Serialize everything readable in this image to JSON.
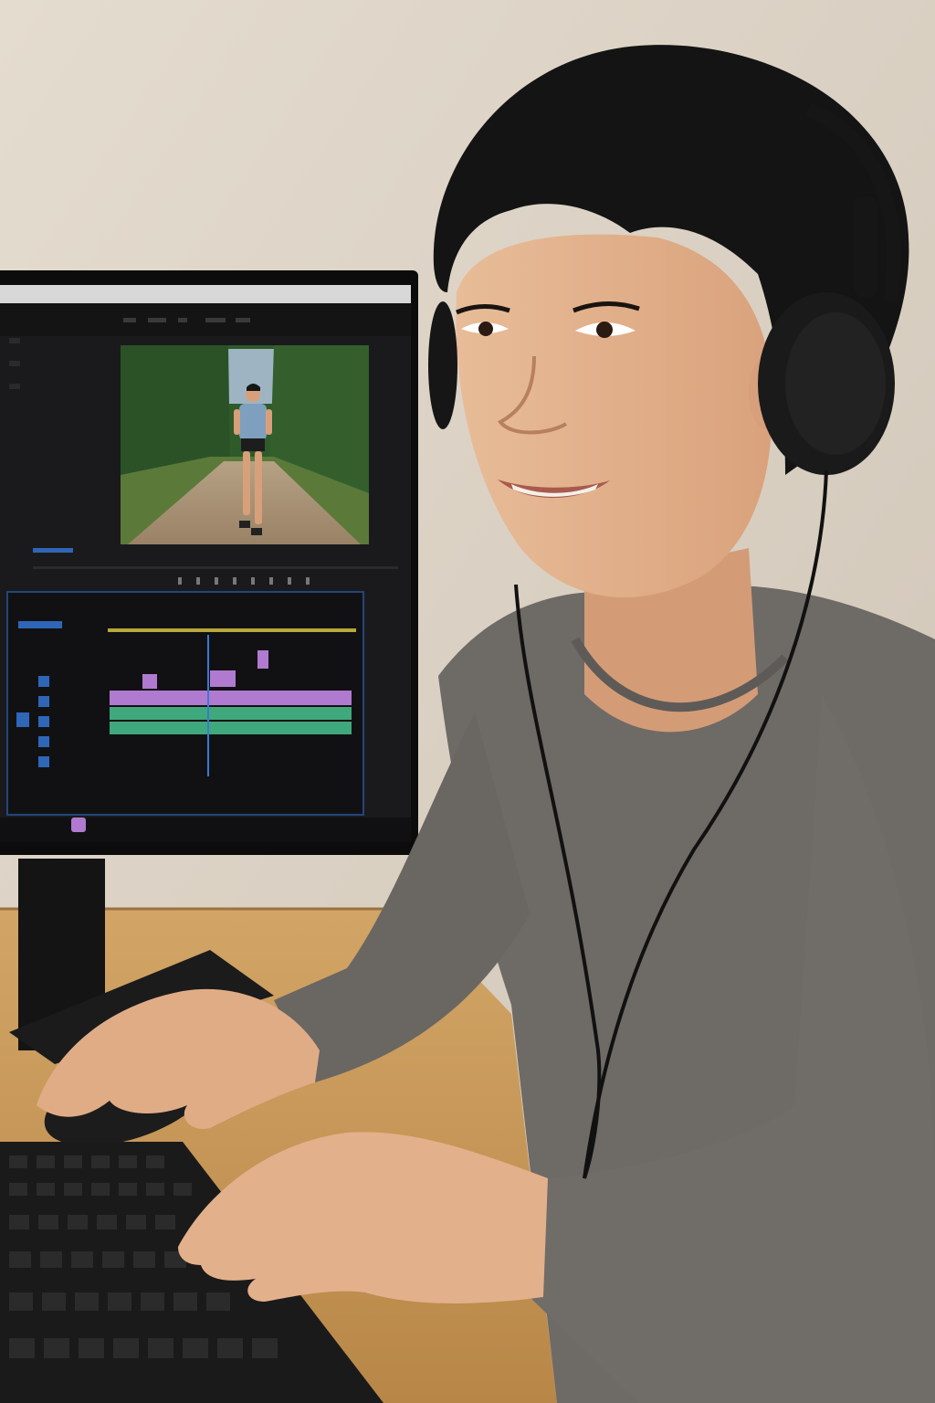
{
  "scene": {
    "wall_color": "#ddd4c8",
    "desk_color": "#c99a5a",
    "shirt_color": "#6e6a66",
    "hair_color": "#141414",
    "skin_color": "#e2b18c"
  },
  "monitor": {
    "app": "video-editor",
    "panel_color": "#141414",
    "preview": {
      "sky_color": "#9fb4c2",
      "tree_color": "#2f5a2a",
      "path_color": "#a89274",
      "runner_shirt_color": "#7f9fbf"
    },
    "timeline": {
      "accent_color": "#b7a83a",
      "video_clip_color": "#b07ad0",
      "audio_clip_color": "#3fa87c",
      "track_button_color": "#2f66b8"
    }
  },
  "peripherals": {
    "keyboard_color": "#1a1a1a",
    "mouse_color": "#1c1c1c",
    "headphones_color": "#161616"
  }
}
